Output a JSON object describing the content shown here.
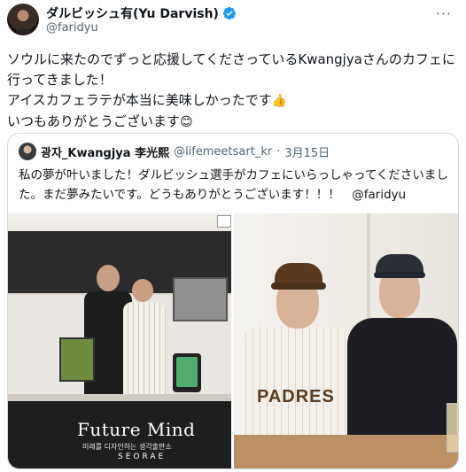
{
  "author": {
    "name": "ダルビッシュ有(Yu Darvish)",
    "handle": "@faridyu",
    "verified": true
  },
  "tweet": {
    "line1": "ソウルに来たのでずっと応援してくださっているKwangjyaさんのカフェに行ってきました！",
    "line2": "アイスカフェラテが本当に美味しかったです",
    "line2_emoji": "👍",
    "line3": "いつもありがとうございます",
    "line3_emoji": "😊"
  },
  "quote": {
    "name": "광자_Kwangjya 李光熙",
    "handle": "@lifemeetsart_kr",
    "separator": "·",
    "date": "3月15日",
    "text": "私の夢が叶いました！ダルビッシュ選手がカフェにいらっしゃってくださいました。まだ夢みたいです。どうもありがとうございます！！！　@faridyu"
  },
  "photo_left": {
    "logo": "Future Mind",
    "logo_korean": "미래를 디자인하는 생각출판소",
    "logo_sub": "SEORAE"
  },
  "photo_right": {
    "jersey_text": "PADRES"
  },
  "colors": {
    "text": "#0f1419",
    "secondary": "#536471",
    "verified": "#1d9bf0",
    "border": "#cfd9de"
  },
  "icons": {
    "verified": "verified-badge-icon",
    "more": "more-options-icon"
  }
}
